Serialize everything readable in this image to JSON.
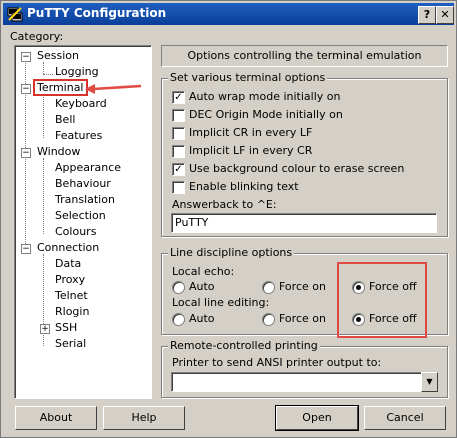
{
  "window": {
    "title": "PuTTY Configuration",
    "help_btn": "?",
    "close_btn": "✕"
  },
  "category_label": "Category:",
  "tree": {
    "session": "Session",
    "logging": "Logging",
    "terminal": "Terminal",
    "keyboard": "Keyboard",
    "bell": "Bell",
    "features": "Features",
    "window": "Window",
    "appearance": "Appearance",
    "behaviour": "Behaviour",
    "translation": "Translation",
    "selection": "Selection",
    "colours": "Colours",
    "connection": "Connection",
    "data": "Data",
    "proxy": "Proxy",
    "telnet": "Telnet",
    "rlogin": "Rlogin",
    "ssh": "SSH",
    "serial": "Serial",
    "minus": "−",
    "plus": "+"
  },
  "header": "Options controlling the terminal emulation",
  "terminal_options": {
    "legend": "Set various terminal options",
    "auto_wrap": {
      "label": "Auto wrap mode initially on",
      "checked": true
    },
    "dec_origin": {
      "label": "DEC Origin Mode initially on",
      "checked": false
    },
    "implicit_cr": {
      "label": "Implicit CR in every LF",
      "checked": false
    },
    "implicit_lf": {
      "label": "Implicit LF in every CR",
      "checked": false
    },
    "bg_colour": {
      "label": "Use background colour to erase screen",
      "checked": true
    },
    "blinking": {
      "label": "Enable blinking text",
      "checked": false
    },
    "answerback_label": "Answerback to ^E:",
    "answerback_value": "PuTTY"
  },
  "line_discipline": {
    "legend": "Line discipline options",
    "local_echo_label": "Local echo:",
    "local_editing_label": "Local line editing:",
    "auto": "Auto",
    "force_on": "Force on",
    "force_off": "Force off",
    "local_echo_selected": "Force off",
    "local_editing_selected": "Force off"
  },
  "printing": {
    "legend": "Remote-controlled printing",
    "printer_label": "Printer to send ANSI printer output to:",
    "printer_value": "",
    "dropdown_arrow": "▼"
  },
  "buttons": {
    "about": "About",
    "help": "Help",
    "open": "Open",
    "cancel": "Cancel"
  },
  "check_glyph": "✓",
  "colors": {
    "title_bar": "#0a3f9a",
    "face": "#d4d0c8",
    "annotation_red": "#e04a43"
  }
}
